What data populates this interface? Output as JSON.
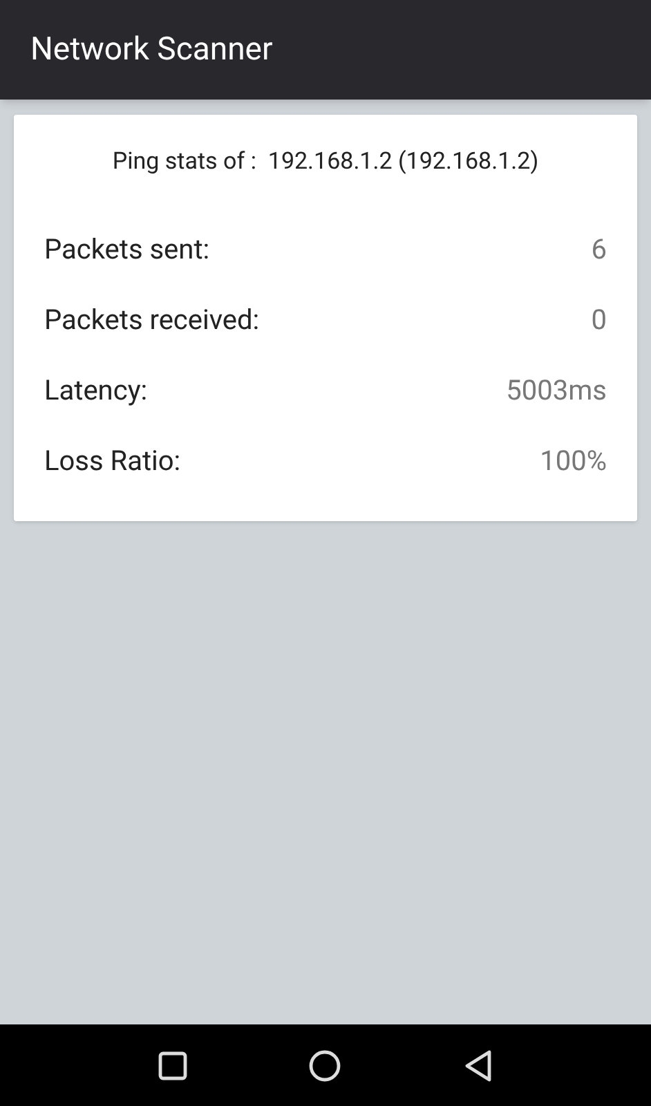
{
  "app_bar": {
    "title": "Network Scanner"
  },
  "card": {
    "heading": "Ping stats of :  192.168.1.2 (192.168.1.2)",
    "rows": [
      {
        "label": "Packets sent:",
        "value": "6"
      },
      {
        "label": "Packets received:",
        "value": "0"
      },
      {
        "label": "Latency:",
        "value": "5003ms"
      },
      {
        "label": "Loss Ratio:",
        "value": "100%"
      }
    ]
  },
  "nav_bar": {
    "buttons": [
      {
        "kind": "recents"
      },
      {
        "kind": "home"
      },
      {
        "kind": "back"
      }
    ]
  }
}
